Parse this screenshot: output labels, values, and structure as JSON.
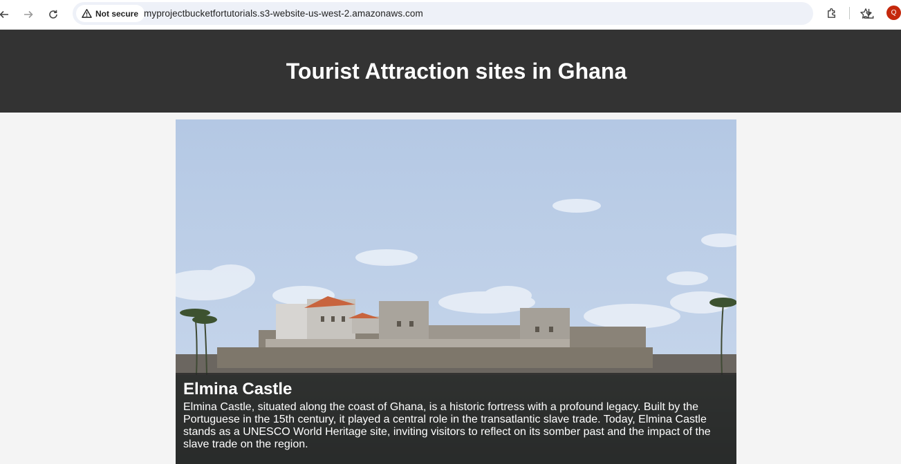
{
  "browser": {
    "security_label": "Not secure",
    "url": "myprojectbucketfortutorials.s3-website-us-west-2.amazonaws.com",
    "avatar_letter": "Q",
    "icons": [
      "back-icon",
      "forward-icon",
      "reload-icon",
      "warning-icon",
      "star-icon",
      "extensions-icon",
      "download-icon"
    ]
  },
  "page": {
    "title": "Tourist Attraction sites in Ghana",
    "attractions": [
      {
        "name": "Elmina Castle",
        "description": "Elmina Castle, situated along the coast of Ghana, is a historic fortress with a profound legacy. Built by the Portuguese in the 15th century, it played a central role in the transatlantic slave trade. Today, Elmina Castle stands as a UNESCO World Heritage site, inviting visitors to reflect on its somber past and the impact of the slave trade on the region."
      }
    ]
  },
  "colors": {
    "header_bg": "#333333",
    "page_bg": "#f4f4f4",
    "avatar_bg": "#c5280c"
  }
}
